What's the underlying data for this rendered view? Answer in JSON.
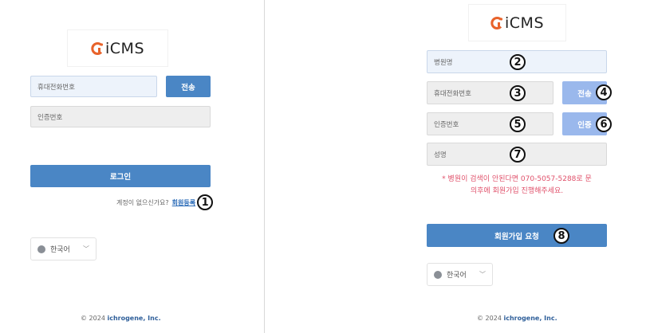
{
  "brand": {
    "name": "iCMS",
    "accent": "#e8632b",
    "primary": "#4a86c5"
  },
  "login": {
    "phone_placeholder": "휴대전화번호",
    "send_label": "전송",
    "code_placeholder": "인증번호",
    "login_label": "로그인",
    "signup_prompt": "계정이 없으신가요?",
    "signup_link": "회원등록",
    "marker_1": "①",
    "language": "한국어",
    "footer_year": "© 2024",
    "footer_company": "ichrogene, Inc."
  },
  "signup": {
    "hospital_placeholder": "병원명",
    "phone_placeholder": "휴대전화번호",
    "send_label": "전송",
    "code_placeholder": "인증번호",
    "verify_label": "인증",
    "name_placeholder": "성명",
    "notice_line1": "* 병원이 검색이 안된다면 070-5057-5288로 문",
    "notice_line2": "의후에 회원가입 진행해주세요.",
    "submit_label": "회원가입 요청",
    "markers": [
      "2",
      "3",
      "4",
      "5",
      "6",
      "7",
      "8"
    ],
    "language": "한국어",
    "footer_year": "© 2024",
    "footer_company": "ichrogene, Inc."
  }
}
